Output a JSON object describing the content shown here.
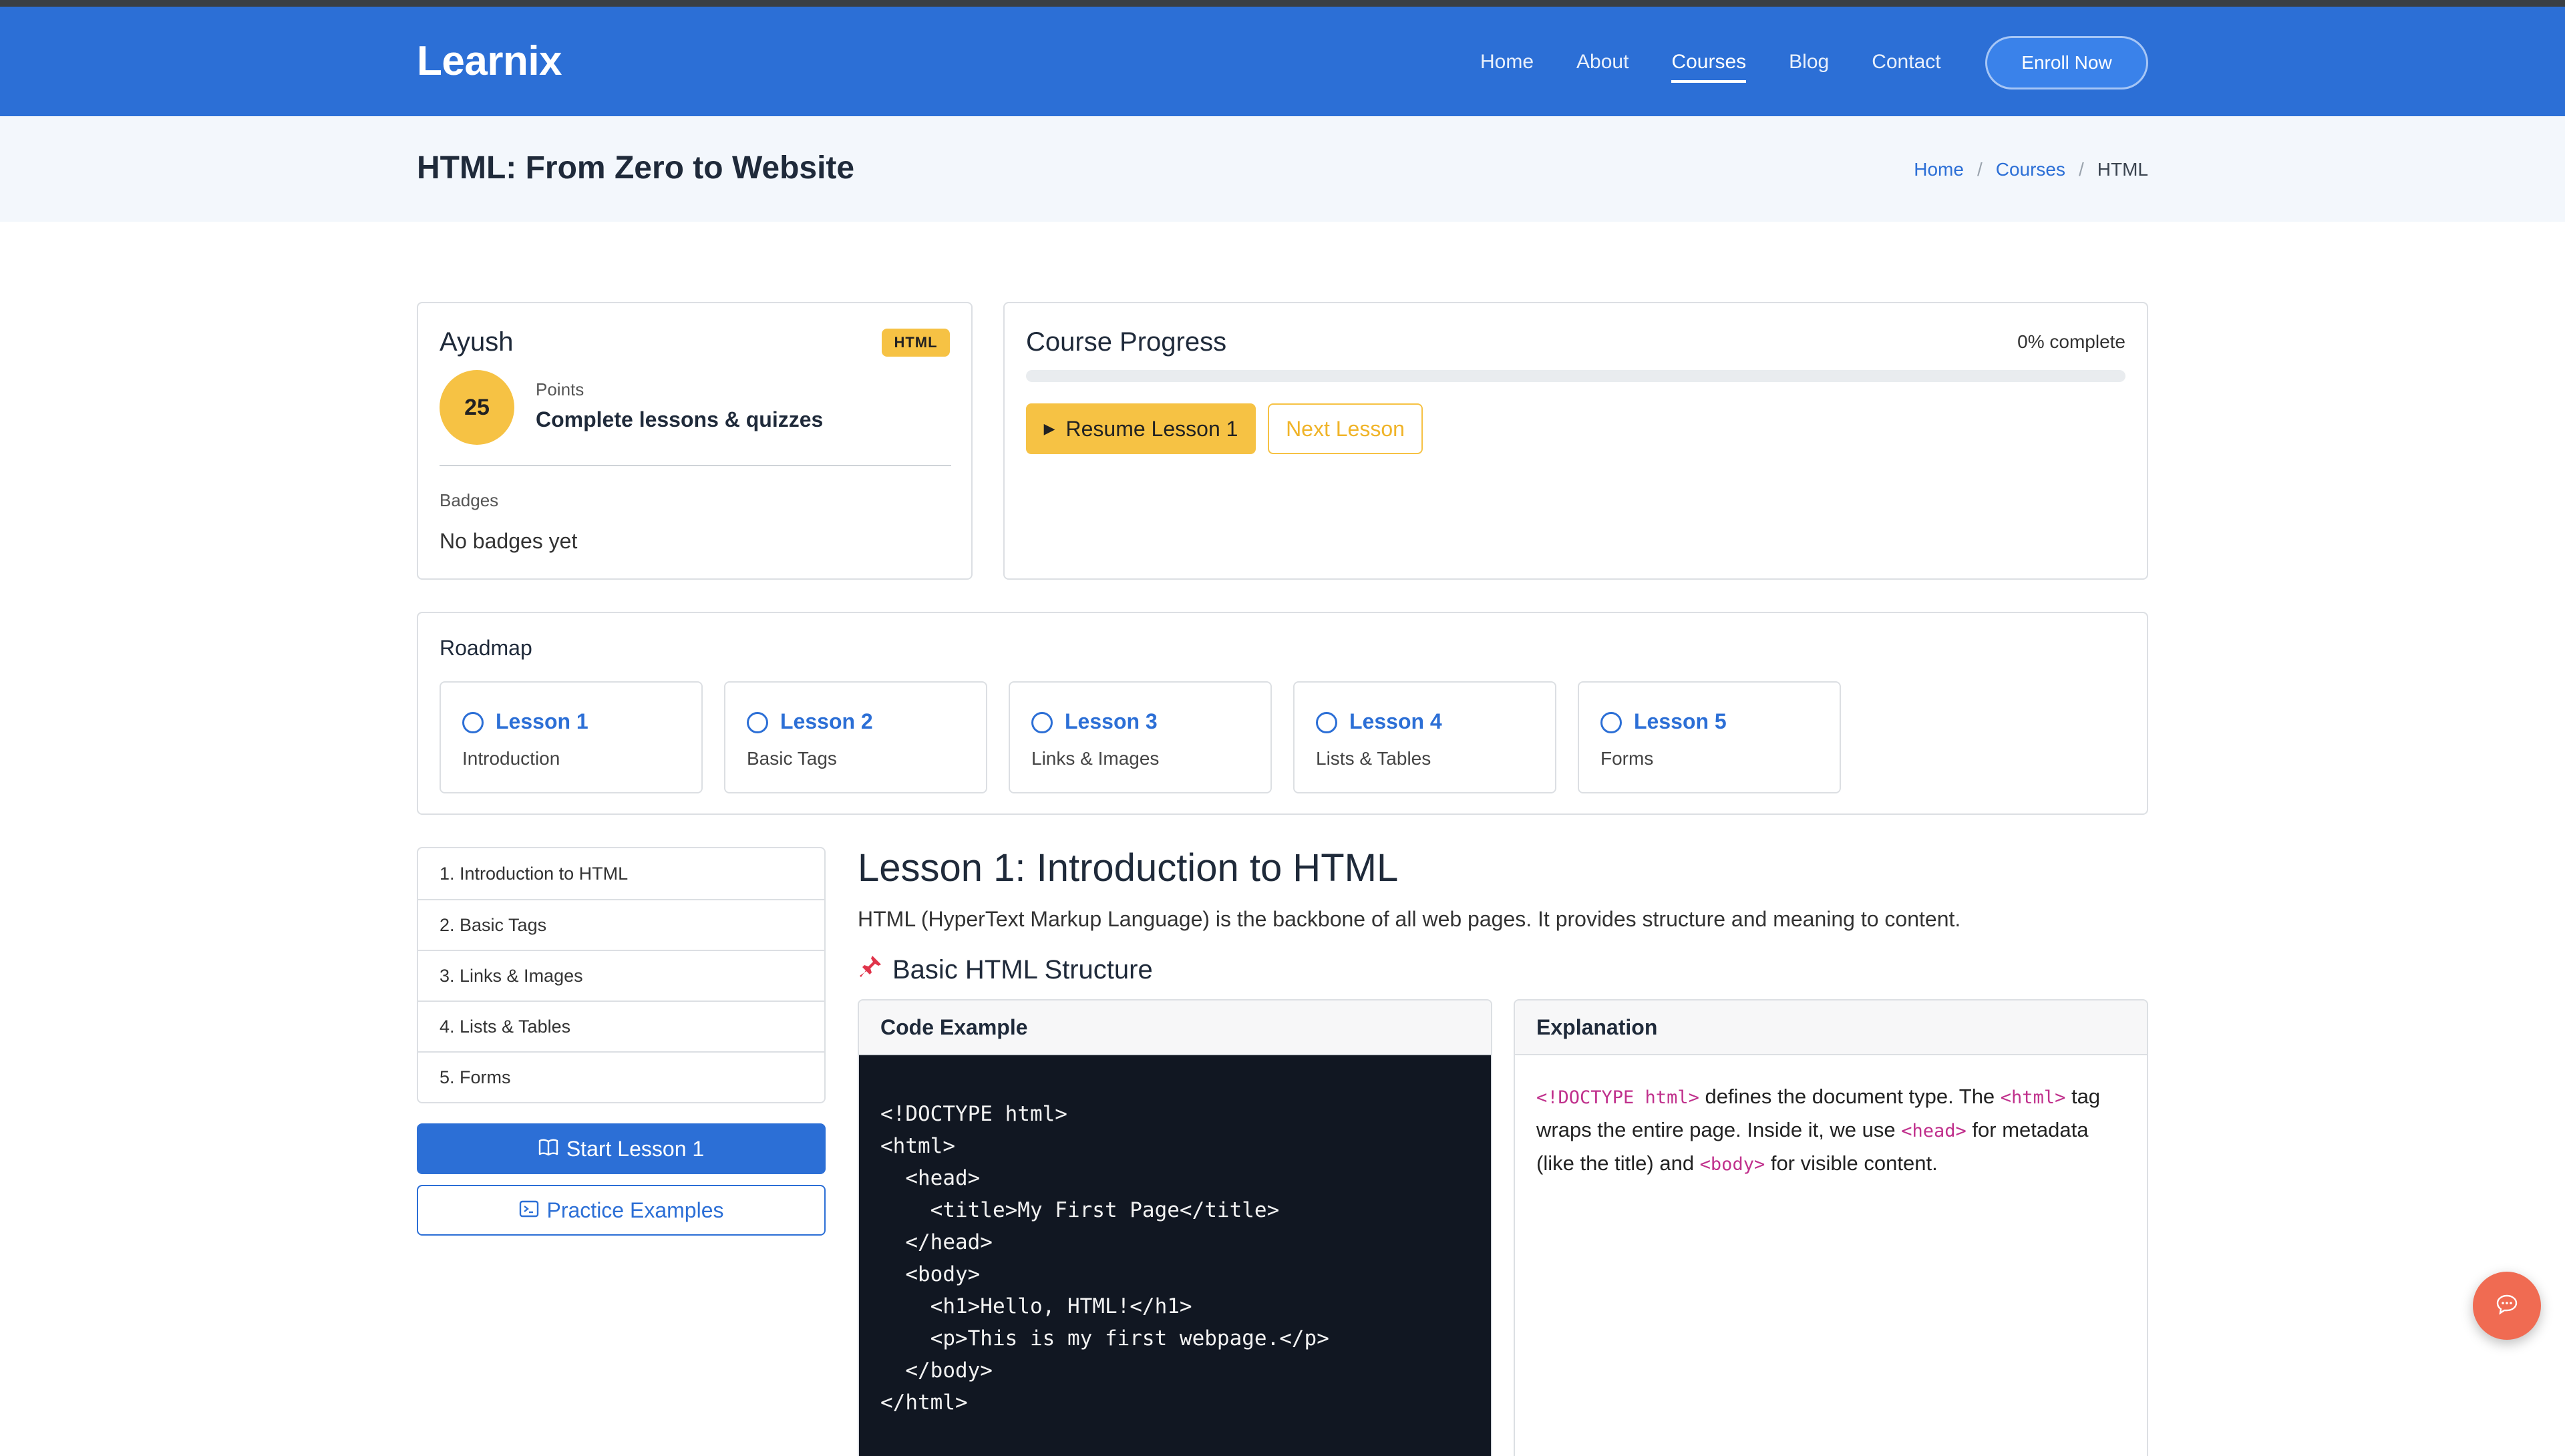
{
  "header": {
    "brand": "Learnix",
    "nav": [
      "Home",
      "About",
      "Courses",
      "Blog",
      "Contact"
    ],
    "active_nav": "Courses",
    "enroll_label": "Enroll Now"
  },
  "titlebar": {
    "title": "HTML: From Zero to Website",
    "breadcrumb": {
      "home": "Home",
      "courses": "Courses",
      "current": "HTML",
      "separator": "/"
    }
  },
  "user": {
    "name": "Ayush",
    "course_badge": "HTML",
    "points": "25",
    "points_label": "Points",
    "points_hint": "Complete lessons & quizzes",
    "badges_label": "Badges",
    "badges_value": "No badges yet"
  },
  "progress": {
    "title": "Course Progress",
    "percent_text": "0% complete",
    "percent": 0,
    "resume_label": "Resume Lesson 1",
    "next_label": "Next Lesson"
  },
  "roadmap": {
    "title": "Roadmap",
    "items": [
      {
        "name": "Lesson 1",
        "sub": "Introduction"
      },
      {
        "name": "Lesson 2",
        "sub": "Basic Tags"
      },
      {
        "name": "Lesson 3",
        "sub": "Links & Images"
      },
      {
        "name": "Lesson 4",
        "sub": "Lists & Tables"
      },
      {
        "name": "Lesson 5",
        "sub": "Forms"
      }
    ]
  },
  "lessons": {
    "items": [
      "1. Introduction to HTML",
      "2. Basic Tags",
      "3. Links & Images",
      "4. Lists & Tables",
      "5. Forms"
    ],
    "start_label": "Start Lesson 1",
    "practice_label": "Practice Examples"
  },
  "content": {
    "heading": "Lesson 1: Introduction to HTML",
    "intro": "HTML (HyperText Markup Language) is the backbone of all web pages. It provides structure and meaning to content.",
    "section_heading": "Basic HTML Structure",
    "code_header": "Code Example",
    "code_lines": [
      "<!DOCTYPE html>",
      "<html>",
      "  <head>",
      "    <title>My First Page</title>",
      "  </head>",
      "  <body>",
      "    <h1>Hello, HTML!</h1>",
      "    <p>This is my first webpage.</p>",
      "  </body>",
      "</html>"
    ],
    "explanation_header": "Explanation",
    "explanation": {
      "code1": "<!DOCTYPE html>",
      "text1": " defines the document type. The ",
      "code2": "<html>",
      "text2": " tag wraps the entire page. Inside it, we use ",
      "code3": "<head>",
      "text3": " for metadata (like the title) and ",
      "code4": "<body>",
      "text4": " for visible content."
    }
  },
  "colors": {
    "primary": "#2c6fd6",
    "accent": "#f6c244",
    "code_bg": "#111722",
    "chat": "#f06b52"
  }
}
